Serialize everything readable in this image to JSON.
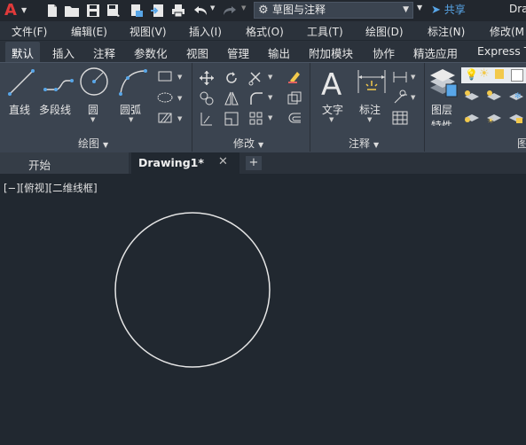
{
  "app": {
    "logo": "A",
    "logo_color": "#e03a3a",
    "title_right": "Dra"
  },
  "quick_access": {
    "icons": [
      "new-file-icon",
      "open-folder-icon",
      "save-icon",
      "save-as-icon",
      "publish-icon",
      "plot-icon",
      "print-icon",
      "undo-icon",
      "redo-icon"
    ],
    "workspace": "草图与注释",
    "share": "共享"
  },
  "menu": {
    "items": [
      "文件(F)",
      "编辑(E)",
      "视图(V)",
      "插入(I)",
      "格式(O)",
      "工具(T)",
      "绘图(D)",
      "标注(N)",
      "修改(M"
    ]
  },
  "ribbon_tabs": {
    "items": [
      "默认",
      "插入",
      "注释",
      "参数化",
      "视图",
      "管理",
      "输出",
      "附加模块",
      "协作",
      "精选应用",
      "Express T"
    ],
    "active": "默认"
  },
  "ribbon": {
    "draw": {
      "line": "直线",
      "polyline": "多段线",
      "circle": "圆",
      "arc": "圆弧",
      "panel_title": "绘图"
    },
    "modify": {
      "panel_title": "修改"
    },
    "annotation": {
      "text": "文字",
      "dimension": "标注",
      "panel_title": "注释"
    },
    "layers": {
      "layer_properties": "图层",
      "layer_properties_2": "特性",
      "panel_title": "图"
    }
  },
  "file_tabs": {
    "start": "开始",
    "drawing": "Drawing1*",
    "close": "✕",
    "add": "+"
  },
  "canvas": {
    "viewport_controls": "[−][俯视][二维线框]",
    "background": "#212830",
    "object": "circle"
  },
  "colors": {
    "accent": "#58a6e8",
    "ribbon_bg": "#3b4450",
    "canvas_bg": "#212830"
  }
}
